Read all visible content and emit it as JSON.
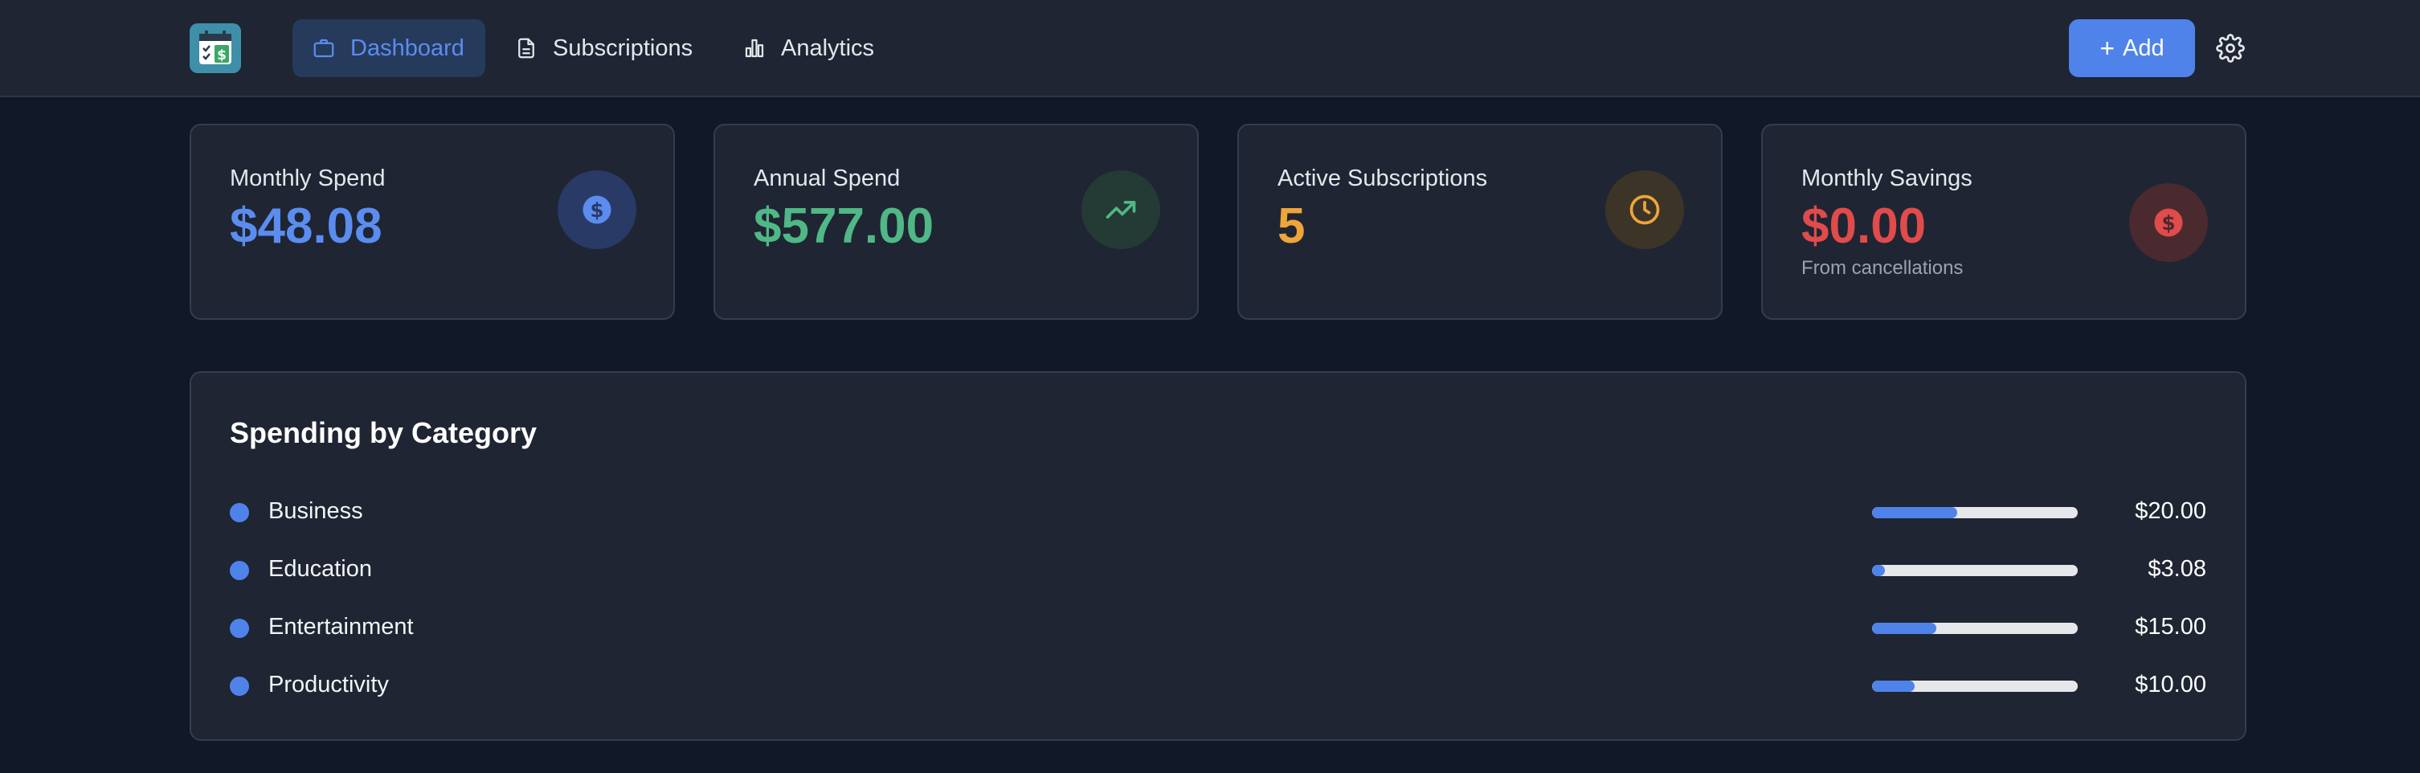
{
  "nav": {
    "items": [
      {
        "label": "Dashboard",
        "icon": "briefcase-icon",
        "active": true
      },
      {
        "label": "Subscriptions",
        "icon": "document-icon",
        "active": false
      },
      {
        "label": "Analytics",
        "icon": "bar-chart-icon",
        "active": false
      }
    ],
    "add_label": "Add"
  },
  "stats": [
    {
      "label": "Monthly Spend",
      "value": "$48.08",
      "sub": "",
      "icon": "dollar-icon",
      "color": "#5b8def",
      "icon_bg": "#2a3a66"
    },
    {
      "label": "Annual Spend",
      "value": "$577.00",
      "sub": "",
      "icon": "trending-up-icon",
      "color": "#4fb886",
      "icon_bg": "#243a35"
    },
    {
      "label": "Active Subscriptions",
      "value": "5",
      "sub": "",
      "icon": "clock-icon",
      "color": "#eea53a",
      "icon_bg": "#3d3428"
    },
    {
      "label": "Monthly Savings",
      "value": "$0.00",
      "sub": "From cancellations",
      "icon": "dollar-icon",
      "color": "#e04b4b",
      "icon_bg": "#4a2a2e"
    }
  ],
  "category_panel": {
    "title": "Spending by Category",
    "categories": [
      {
        "name": "Business",
        "amount": "$20.00",
        "share": 0.416
      },
      {
        "name": "Education",
        "amount": "$3.08",
        "share": 0.064
      },
      {
        "name": "Entertainment",
        "amount": "$15.00",
        "share": 0.312
      },
      {
        "name": "Productivity",
        "amount": "$10.00",
        "share": 0.208
      }
    ],
    "dot_color": "#4f83ea",
    "bar_color": "#4f83ea"
  }
}
